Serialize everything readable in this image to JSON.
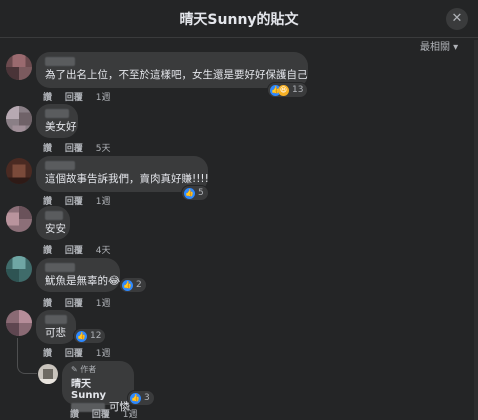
{
  "header": {
    "title": "晴天Sunny的貼文",
    "close_icon": "✕"
  },
  "sort": {
    "label": "最相關 ▾"
  },
  "reaction_colors": {
    "like": "#2e89ff",
    "haha": "#f7b125"
  },
  "comments": [
    {
      "text": "為了出名上位，不至於這樣吧，女生還是要好好保護自己",
      "reactions": [
        "like",
        "haha"
      ],
      "count": "13",
      "actions": [
        "讚",
        "回覆",
        "1週"
      ]
    },
    {
      "text": "美女好",
      "reactions": [],
      "count": "",
      "actions": [
        "讚",
        "回覆",
        "5天"
      ]
    },
    {
      "text": "這個故事告訴我們，賣肉真好賺!!!!",
      "reactions": [
        "like"
      ],
      "count": "5",
      "actions": [
        "讚",
        "回覆",
        "1週"
      ]
    },
    {
      "text": "安安",
      "reactions": [],
      "count": "",
      "actions": [
        "讚",
        "回覆",
        "4天"
      ]
    },
    {
      "text": "魷魚是無辜的😂",
      "reactions": [
        "like"
      ],
      "count": "2",
      "actions": [
        "讚",
        "回覆",
        "1週"
      ]
    },
    {
      "text": "可悲",
      "reactions": [
        "like"
      ],
      "count": "12",
      "actions": [
        "讚",
        "回覆",
        "1週"
      ]
    }
  ],
  "reply": {
    "badge": "✎ 作者",
    "author": "晴天Sunny",
    "text": "可憐",
    "reactions": [
      "like"
    ],
    "count": "3",
    "actions": [
      "讚",
      "回覆",
      "1週"
    ]
  }
}
